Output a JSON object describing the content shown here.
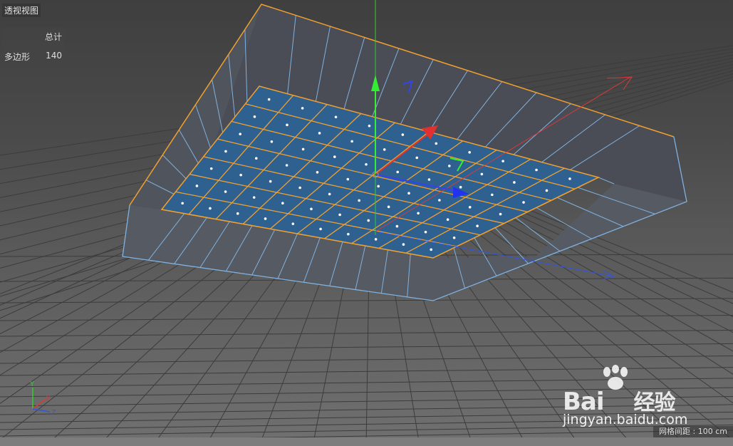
{
  "viewport": {
    "title": "透视视图",
    "background_color": "#5d5d5d"
  },
  "hud": {
    "header": "总计",
    "rows": [
      {
        "label": "多边形",
        "value": "140"
      }
    ]
  },
  "grid_readout": "网格间距 : 100 cm",
  "axes": {
    "x_label": "X",
    "y_label": "Y",
    "z_label": "Z",
    "x_color": "#d93a3a",
    "y_color": "#33cc33",
    "z_color": "#3355dd"
  },
  "mesh": {
    "face_color": "#2e5f8c",
    "edge_color": "#f0a030",
    "wire_color": "#7fb2e0",
    "wall_color": "#4b4f57"
  },
  "watermark": {
    "brand": "Bai",
    "brand2": "经验",
    "url": "jingyan.baidu.com"
  }
}
